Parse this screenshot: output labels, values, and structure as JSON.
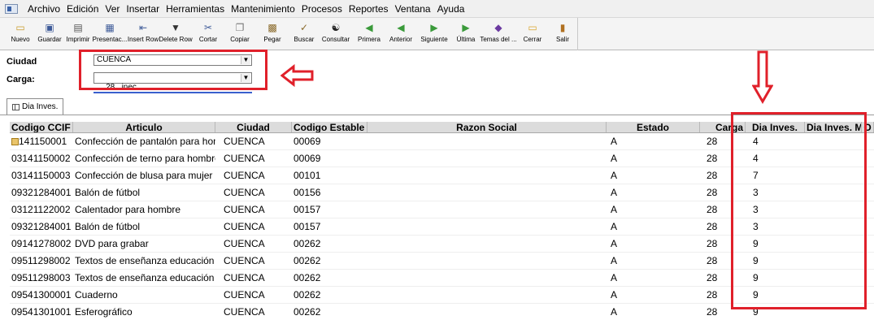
{
  "menu": {
    "items": [
      "Archivo",
      "Edición",
      "Ver",
      "Insertar",
      "Herramientas",
      "Mantenimiento",
      "Procesos",
      "Reportes",
      "Ventana",
      "Ayuda"
    ]
  },
  "toolbar": {
    "buttons": [
      {
        "label": "Nuevo",
        "icon": "new-icon"
      },
      {
        "label": "Guardar",
        "icon": "save-icon"
      },
      {
        "label": "Imprimir",
        "icon": "print-icon"
      },
      {
        "label": "Presentac...",
        "icon": "preview-icon"
      },
      {
        "label": "Insert Row",
        "icon": "insert-row-icon"
      },
      {
        "label": "Delete Row",
        "icon": "trash-icon"
      },
      {
        "label": "Cortar",
        "icon": "scissors-icon"
      },
      {
        "label": "Copiar",
        "icon": "copy-icon"
      },
      {
        "label": "Pegar",
        "icon": "paste-icon"
      },
      {
        "label": "Buscar",
        "icon": "search-icon"
      },
      {
        "label": "Consultar",
        "icon": "binoculars-icon"
      },
      {
        "label": "Primera",
        "icon": "first-icon"
      },
      {
        "label": "Anterior",
        "icon": "previous-icon"
      },
      {
        "label": "Siguiente",
        "icon": "next-icon"
      },
      {
        "label": "Última",
        "icon": "last-icon"
      },
      {
        "label": "Temas del ...",
        "icon": "themes-icon"
      },
      {
        "label": "Cerrar",
        "icon": "folder-close-icon"
      },
      {
        "label": "Salir",
        "icon": "exit-icon"
      }
    ]
  },
  "filters": {
    "ciudad_label": "Ciudad",
    "ciudad_value": "CUENCA",
    "carga_label": "Carga:",
    "carga_value": "28   inec"
  },
  "tab": {
    "label": "Dia Inves."
  },
  "grid": {
    "headers": [
      "Codigo CCIF",
      "Articulo",
      "Ciudad",
      "Codigo Estable",
      "Razon Social",
      "Estado",
      "Carga",
      "Dia Inves.",
      "Dia Inves. Mod.",
      "O"
    ],
    "rows": [
      [
        "03141150001",
        "Confección de pantalón para hom",
        "CUENCA",
        "00069",
        "",
        "A",
        "28",
        "4",
        ""
      ],
      [
        "03141150002",
        "Confección de terno para hombre",
        "CUENCA",
        "00069",
        "",
        "A",
        "28",
        "4",
        ""
      ],
      [
        "03141150003",
        "Confección de blusa para mujer",
        "CUENCA",
        "00101",
        "",
        "A",
        "28",
        "7",
        ""
      ],
      [
        "09321284001",
        "Balón de fútbol",
        "CUENCA",
        "00156",
        "",
        "A",
        "28",
        "3",
        ""
      ],
      [
        "03121122002",
        "Calentador para hombre",
        "CUENCA",
        "00157",
        "",
        "A",
        "28",
        "3",
        ""
      ],
      [
        "09321284001",
        "Balón de fútbol",
        "CUENCA",
        "00157",
        "",
        "A",
        "28",
        "3",
        ""
      ],
      [
        "09141278002",
        "DVD para grabar",
        "CUENCA",
        "00262",
        "",
        "A",
        "28",
        "9",
        ""
      ],
      [
        "09511298002",
        "Textos de enseñanza educación b",
        "CUENCA",
        "00262",
        "",
        "A",
        "28",
        "9",
        ""
      ],
      [
        "09511298003",
        "Textos de enseñanza educación b",
        "CUENCA",
        "00262",
        "",
        "A",
        "28",
        "9",
        ""
      ],
      [
        "09541300001",
        "Cuaderno",
        "CUENCA",
        "00262",
        "",
        "A",
        "28",
        "9",
        ""
      ],
      [
        "09541301001",
        "Esferográfico",
        "CUENCA",
        "00262",
        "",
        "A",
        "28",
        "9",
        ""
      ]
    ]
  },
  "annotation_color": "#e0202a"
}
